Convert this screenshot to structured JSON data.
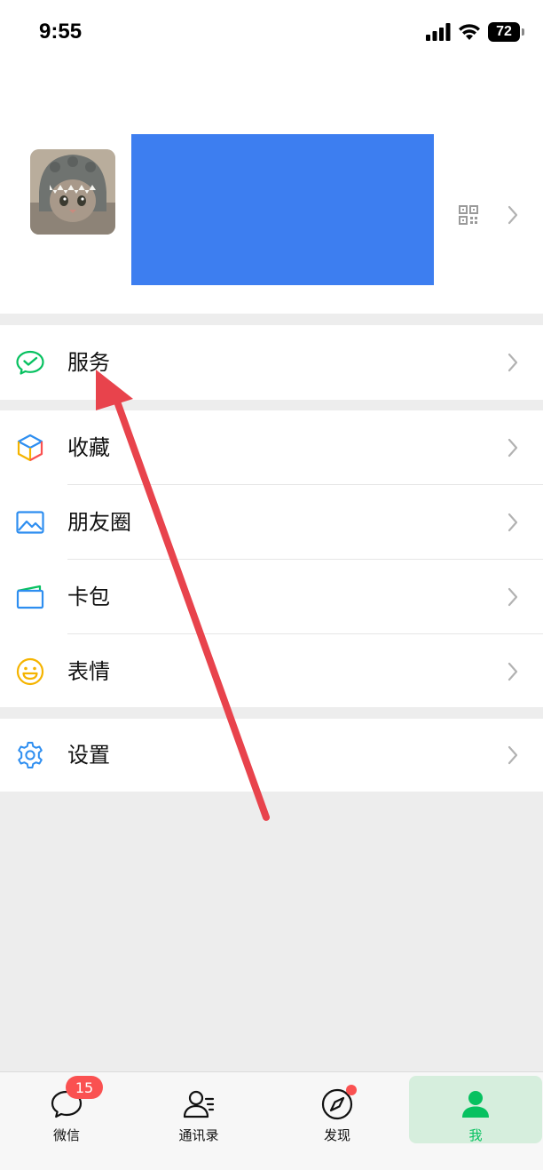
{
  "status_bar": {
    "time": "9:55",
    "battery": "72"
  },
  "profile": {
    "avatar_icon": "avatar-cat-photo",
    "name_redacted": true,
    "qr_icon": "qrcode-icon",
    "chevron_icon": "chevron-right-icon"
  },
  "menu": {
    "service": {
      "label": "服务",
      "icon": "wechat-pay-icon"
    },
    "favorites": {
      "label": "收藏",
      "icon": "cube-icon"
    },
    "moments": {
      "label": "朋友圈",
      "icon": "image-icon"
    },
    "cards": {
      "label": "卡包",
      "icon": "card-wallet-icon"
    },
    "stickers": {
      "label": "表情",
      "icon": "smiley-icon"
    },
    "settings": {
      "label": "设置",
      "icon": "gear-icon"
    }
  },
  "tabbar": {
    "chats": {
      "label": "微信",
      "badge": "15"
    },
    "contacts": {
      "label": "通讯录"
    },
    "discover": {
      "label": "发现",
      "has_dot": true
    },
    "me": {
      "label": "我",
      "active": true
    }
  },
  "colors": {
    "accent_green": "#07c160",
    "badge_red": "#fa5151",
    "redaction_blue": "#3d7ef0",
    "annotation_arrow": "#e8434c",
    "background": "#ededed"
  }
}
